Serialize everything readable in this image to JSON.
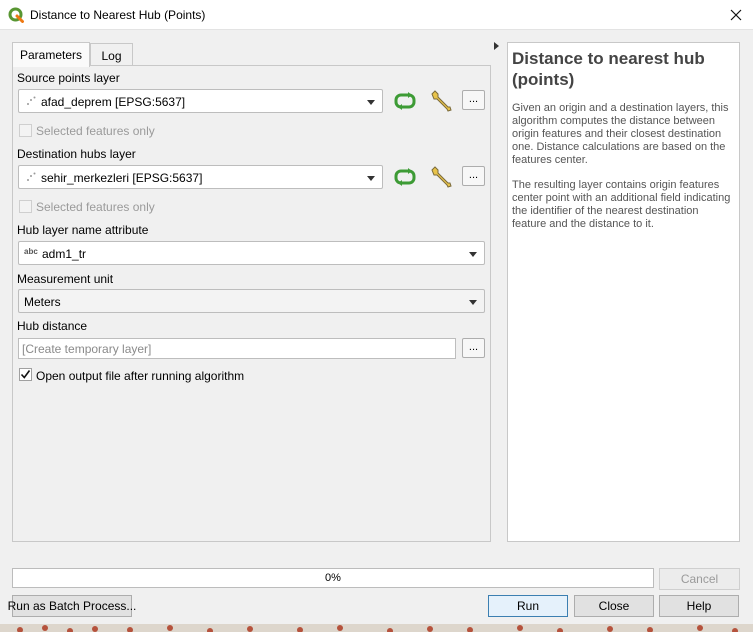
{
  "window": {
    "title": "Distance to Nearest Hub (Points)",
    "accent_color": "#589632"
  },
  "tabs": [
    {
      "label": "Parameters"
    },
    {
      "label": "Log"
    }
  ],
  "params": {
    "source_label": "Source points layer",
    "source_value": "afad_deprem [EPSG:5637]",
    "selected_only_label": "Selected features only",
    "dest_label": "Destination hubs layer",
    "dest_value": "sehir_merkezleri [EPSG:5637]",
    "hub_name_label": "Hub layer name attribute",
    "hub_name_value": "adm1_tr",
    "hub_name_field_type": "abc",
    "unit_label": "Measurement unit",
    "unit_value": "Meters",
    "hub_distance_label": "Hub distance",
    "hub_distance_placeholder": "[Create temporary layer]",
    "browse_label": "...",
    "open_output_label": "Open output file after running algorithm",
    "open_output_checked": true
  },
  "help": {
    "title": "Distance to nearest hub (points)",
    "para1": "Given an origin and a destination layers, this algorithm computes the distance between origin features and their closest destination one. Distance calculations are based on the features center.",
    "para2": "The resulting layer contains origin features center point with an additional field indicating the identifier of the nearest destination feature and the distance to it."
  },
  "progress": {
    "value": 0,
    "label": "0%"
  },
  "buttons": {
    "cancel": "Cancel",
    "batch": "Run as Batch Process...",
    "run": "Run",
    "close": "Close",
    "help": "Help"
  }
}
